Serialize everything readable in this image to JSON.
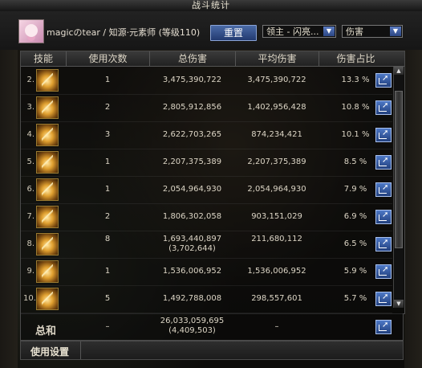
{
  "window": {
    "title": "战斗统计"
  },
  "header": {
    "character": "magicのtear / 知源·元素师 (等级110)",
    "reset_label": "重置",
    "target_select": "领主 - 闪亮...",
    "type_select": "伤害"
  },
  "table": {
    "columns": [
      "技能",
      "使用次数",
      "总伤害",
      "平均伤害",
      "伤害占比"
    ],
    "rows": [
      {
        "rank": "2.",
        "count": "1",
        "total": "3,475,390,722",
        "total_sub": "",
        "avg": "3,475,390,722",
        "pct": "13.3 %"
      },
      {
        "rank": "3.",
        "count": "2",
        "total": "2,805,912,856",
        "total_sub": "",
        "avg": "1,402,956,428",
        "pct": "10.8 %"
      },
      {
        "rank": "4.",
        "count": "3",
        "total": "2,622,703,265",
        "total_sub": "",
        "avg": "874,234,421",
        "pct": "10.1 %"
      },
      {
        "rank": "5.",
        "count": "1",
        "total": "2,207,375,389",
        "total_sub": "",
        "avg": "2,207,375,389",
        "pct": "8.5 %"
      },
      {
        "rank": "6.",
        "count": "1",
        "total": "2,054,964,930",
        "total_sub": "",
        "avg": "2,054,964,930",
        "pct": "7.9 %"
      },
      {
        "rank": "7.",
        "count": "2",
        "total": "1,806,302,058",
        "total_sub": "",
        "avg": "903,151,029",
        "pct": "6.9 %"
      },
      {
        "rank": "8.",
        "count": "8",
        "total": "1,693,440,897",
        "total_sub": "(3,702,644)",
        "avg": "211,680,112",
        "pct": "6.5 %"
      },
      {
        "rank": "9.",
        "count": "1",
        "total": "1,536,006,952",
        "total_sub": "",
        "avg": "1,536,006,952",
        "pct": "5.9 %"
      },
      {
        "rank": "10.",
        "count": "5",
        "total": "1,492,788,008",
        "total_sub": "",
        "avg": "298,557,601",
        "pct": "5.7 %"
      }
    ]
  },
  "totals": {
    "label": "总和",
    "count": "–",
    "total": "26,033,059,695",
    "total_sub": "(4,409,503)",
    "avg": "–"
  },
  "footer": {
    "settings_label": "使用设置"
  },
  "icons": {
    "skill": "skill-icon",
    "detail": "share-detail-icon",
    "scroll_up": "scroll-up-arrow-icon",
    "scroll_down": "scroll-down-arrow-icon"
  }
}
